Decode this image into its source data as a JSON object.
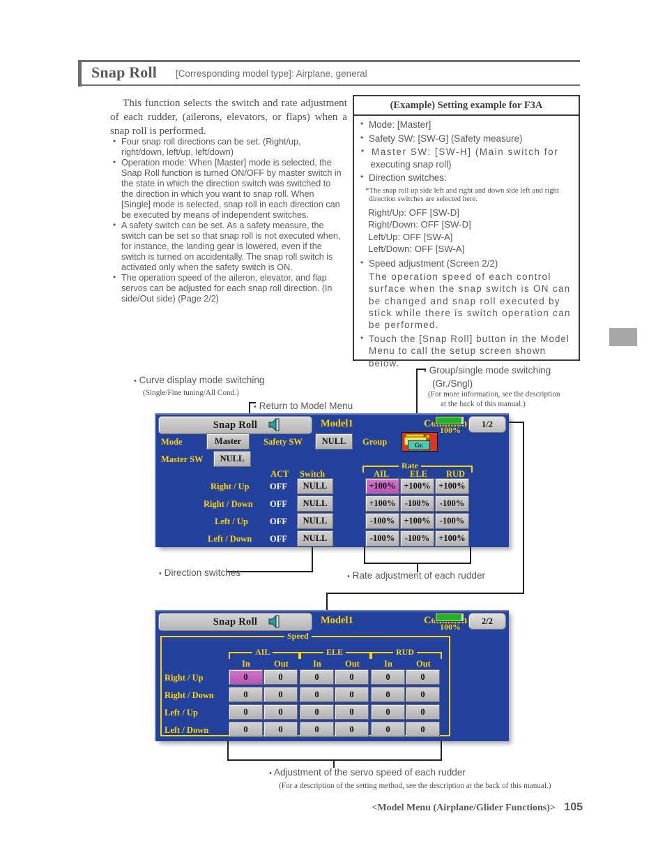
{
  "header": {
    "title": "Snap Roll",
    "subtitle": "[Corresponding model type]: Airplane, general"
  },
  "intro": {
    "paragraph": "This function selects the switch and rate adjustment of each rudder, (ailerons, elevators, or flaps) when a snap roll is performed.",
    "bullets": [
      "Four snap roll directions can be set. (Right/up, right/down, left/up, left/down)",
      "Operation mode: When [Master] mode is selected, the Snap Roll function is turned ON/OFF by master switch in the state in which the direction switch was switched to the direction in which you want to snap roll. When [Single] mode is selected, snap roll in each direction can be executed by means of independent switches.",
      "A safety switch can be set. As a safety measure, the switch can be set so that snap roll is not executed when, for instance, the landing gear is lowered, even if the switch is turned on accidentally. The snap roll switch is activated only when the safety switch is ON.",
      "The operation speed of the aileron, elevator, and flap servos can be adjusted for each snap roll direction. (In side/Out side) (Page 2/2)"
    ]
  },
  "example_box": {
    "title": "(Example) Setting example for F3A",
    "items": [
      "Mode: [Master]",
      "Safety SW: [SW-G] (Safety measure)"
    ],
    "master_sw_line1": "Master SW: [SW-H] (Main switch for",
    "master_sw_line2": "executing snap roll)",
    "direction_switches_label": "Direction switches:",
    "note_line1": "*The snap roll up side left and right and down side left and right",
    "note_line2": "direction switches are selected here.",
    "switch_settings": [
      "Right/Up: OFF [SW-D]",
      "Right/Down: OFF [SW-D]",
      "Left/Up: OFF [SW-A]",
      "Left/Down: OFF [SW-A]"
    ],
    "speed_heading": "Speed adjustment (Screen 2/2)",
    "speed_paragraph": "The operation speed of each control surface when the snap switch is ON can be changed and snap roll executed by stick while there is switch operation can be performed.",
    "touch_paragraph": "Touch the [Snap Roll] button in the Model Menu to call the setup screen shown below."
  },
  "annotations": {
    "curve_display": "Curve display mode switching",
    "curve_display_sub": "(Single/Fine tuning/All Cond.)",
    "return_model_menu": "Return to Model Menu",
    "group_single_line1": "Group/single mode switching",
    "group_single_line2": "(Gr./Sngl)",
    "group_single_sub1": "(For more information, see the description",
    "group_single_sub2": "at the back of this manual.)",
    "direction_switches": "Direction switches",
    "rate_adjustment": "Rate adjustment of each rudder",
    "servo_speed": "Adjustment of the servo speed of each rudder",
    "servo_speed_sub": "(For a description of the setting method, see the description at the back of this manual.)"
  },
  "screen1": {
    "titlebar": {
      "button_label": "Snap Roll",
      "speaker_icon": "speaker-icon",
      "model": "Model1",
      "condition": "Condition 1",
      "battery_pct": "100%",
      "page": "1/2"
    },
    "mode_label": "Mode",
    "mode_value": "Master",
    "master_sw_label": "Master SW",
    "master_sw_value": "NULL",
    "safety_sw_label": "Safety SW",
    "safety_sw_value": "NULL",
    "group_label": "Group",
    "group_icon_text": "Gr.",
    "col_act": "ACT",
    "col_switch": "Switch",
    "rate_bracket": "Rate",
    "rate_cols": [
      "AIL",
      "ELE",
      "RUD"
    ],
    "rows": [
      {
        "name": "Right / Up",
        "act": "OFF",
        "switch": "NULL",
        "ail": "+100%",
        "ele": "+100%",
        "rud": "+100%"
      },
      {
        "name": "Right / Down",
        "act": "OFF",
        "switch": "NULL",
        "ail": "+100%",
        "ele": "-100%",
        "rud": "-100%"
      },
      {
        "name": "Left  / Up",
        "act": "OFF",
        "switch": "NULL",
        "ail": "-100%",
        "ele": "+100%",
        "rud": "-100%"
      },
      {
        "name": "Left  / Down",
        "act": "OFF",
        "switch": "NULL",
        "ail": "-100%",
        "ele": "-100%",
        "rud": "+100%"
      }
    ]
  },
  "screen2": {
    "titlebar": {
      "button_label": "Snap Roll",
      "speaker_icon": "speaker-icon",
      "model": "Model1",
      "condition": "Condition 1",
      "battery_pct": "100%",
      "page": "2/2"
    },
    "speed_bracket": "Speed",
    "groups": [
      "AIL",
      "ELE",
      "RUD"
    ],
    "subcols": [
      "In",
      "Out",
      "In",
      "Out",
      "In",
      "Out"
    ],
    "rows": [
      {
        "name": "Right / Up",
        "values": [
          "0",
          "0",
          "0",
          "0",
          "0",
          "0"
        ]
      },
      {
        "name": "Right / Down",
        "values": [
          "0",
          "0",
          "0",
          "0",
          "0",
          "0"
        ]
      },
      {
        "name": "Left  / Up",
        "values": [
          "0",
          "0",
          "0",
          "0",
          "0",
          "0"
        ]
      },
      {
        "name": "Left  / Down",
        "values": [
          "0",
          "0",
          "0",
          "0",
          "0",
          "0"
        ]
      }
    ]
  },
  "footer": {
    "section": "<Model Menu (Airplane/Glider Functions)>",
    "page_number": "105"
  },
  "colors": {
    "screen_blue": "#22429e",
    "yellow": "#ffd400",
    "highlight": "#c062b8",
    "battery_green": "#21b421"
  }
}
